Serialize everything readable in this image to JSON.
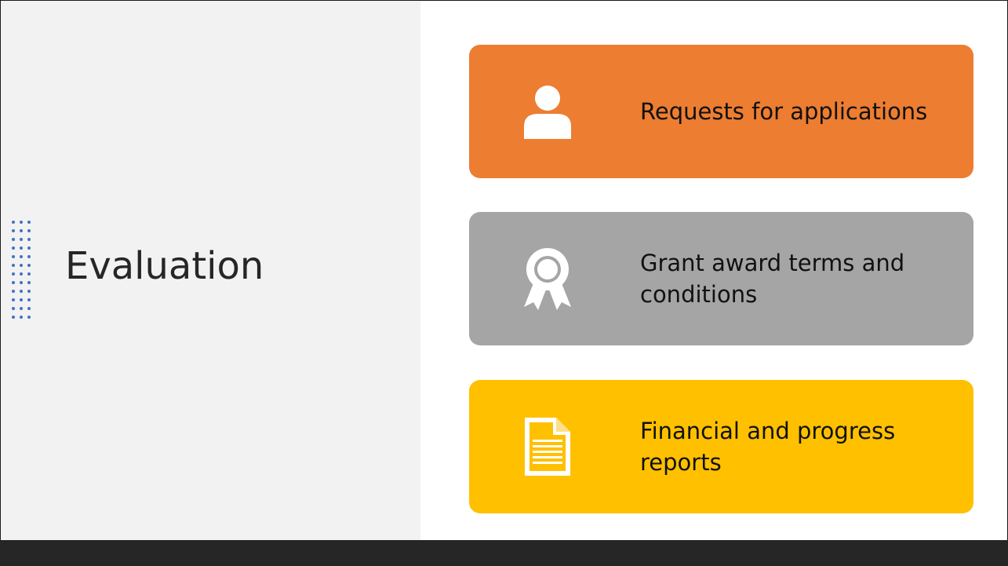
{
  "slide": {
    "title": "Evaluation"
  },
  "cards": [
    {
      "label": "Requests for applications",
      "icon": "person-icon",
      "color": "#ED7D31"
    },
    {
      "label": "Grant award terms and conditions",
      "icon": "award-ribbon-icon",
      "color": "#A5A5A5"
    },
    {
      "label": "Financial and progress reports",
      "icon": "document-icon",
      "color": "#FFC000"
    }
  ],
  "colors": {
    "left_panel": "#F2F2F2",
    "dots": "#4472C4",
    "footer": "#262626"
  }
}
